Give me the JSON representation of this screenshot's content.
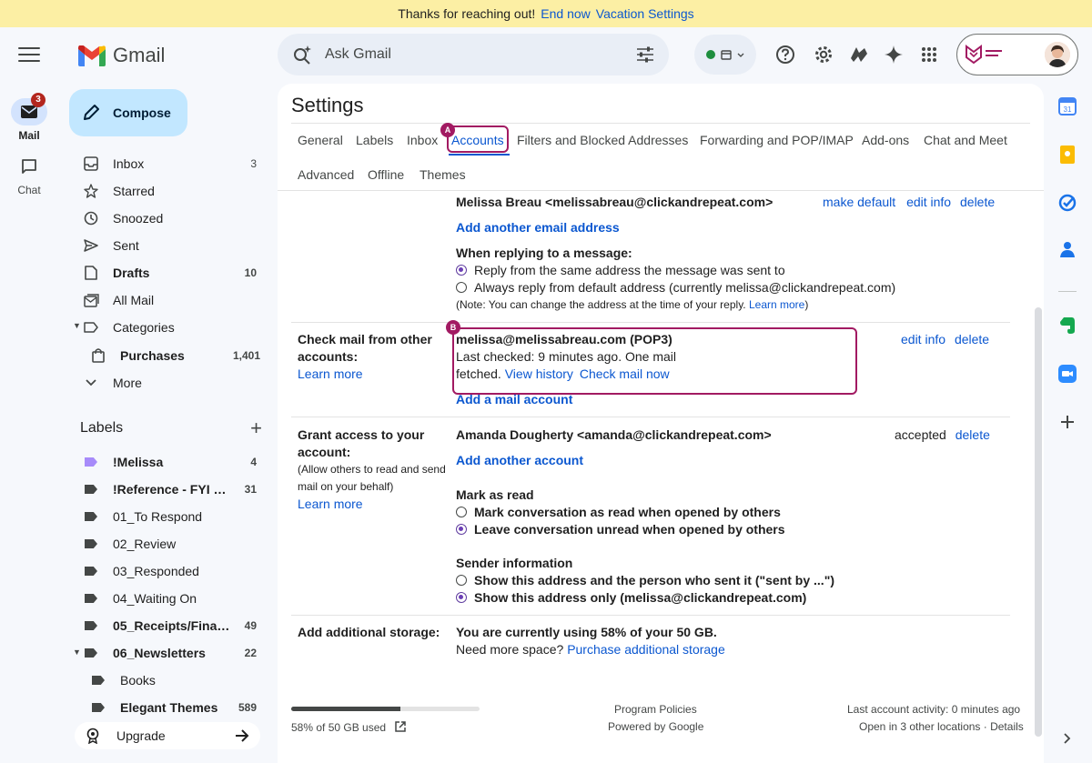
{
  "banner": {
    "text": "Thanks for reaching out!",
    "end_now": "End now",
    "vacation_settings": "Vacation Settings"
  },
  "rail": {
    "mail_label": "Mail",
    "mail_badge": "3",
    "chat_label": "Chat"
  },
  "app": {
    "name": "Gmail"
  },
  "compose_label": "Compose",
  "nav": [
    {
      "label": "Inbox",
      "count": "3",
      "icon": "inbox-icon",
      "bold": true
    },
    {
      "label": "Starred",
      "count": "",
      "icon": "star-icon",
      "bold": false
    },
    {
      "label": "Snoozed",
      "count": "",
      "icon": "clock-icon",
      "bold": false
    },
    {
      "label": "Sent",
      "count": "",
      "icon": "send-icon",
      "bold": false
    },
    {
      "label": "Drafts",
      "count": "10",
      "icon": "draft-icon",
      "bold": true
    },
    {
      "label": "All Mail",
      "count": "",
      "icon": "all-mail-icon",
      "bold": false
    },
    {
      "label": "Categories",
      "count": "",
      "icon": "label-icon",
      "bold": false
    },
    {
      "label": "Purchases",
      "count": "1,401",
      "icon": "shopping-bag-icon",
      "bold": true
    },
    {
      "label": "More",
      "count": "",
      "icon": "chevron-down-icon",
      "bold": false
    }
  ],
  "labels_heading": "Labels",
  "labels": [
    {
      "label": "!Melissa",
      "count": "4",
      "bold": true,
      "color": "#a78bfa"
    },
    {
      "label": "!Reference - FYI + ...",
      "count": "31",
      "bold": true,
      "color": "#444746"
    },
    {
      "label": "01_To Respond",
      "count": "",
      "bold": false,
      "color": "#444746"
    },
    {
      "label": "02_Review",
      "count": "",
      "bold": false,
      "color": "#444746"
    },
    {
      "label": "03_Responded",
      "count": "",
      "bold": false,
      "color": "#444746"
    },
    {
      "label": "04_Waiting On",
      "count": "",
      "bold": false,
      "color": "#444746"
    },
    {
      "label": "05_Receipts/Finan...",
      "count": "49",
      "bold": true,
      "color": "#444746"
    },
    {
      "label": "06_Newsletters",
      "count": "22",
      "bold": true,
      "color": "#444746"
    },
    {
      "label": "Books",
      "count": "",
      "bold": false,
      "color": "#444746"
    },
    {
      "label": "Elegant Themes",
      "count": "589",
      "bold": true,
      "color": "#444746"
    }
  ],
  "upgrade_label": "Upgrade",
  "search": {
    "placeholder": "Ask Gmail"
  },
  "settings": {
    "title": "Settings",
    "tabs": [
      "General",
      "Labels",
      "Inbox",
      "Accounts",
      "Filters and Blocked Addresses",
      "Forwarding and POP/IMAP",
      "Add-ons",
      "Chat and Meet",
      "Advanced",
      "Offline",
      "Themes"
    ],
    "active_tab": "Accounts",
    "send_as": {
      "address": "Melissa Breau <melissabreau@clickandrepeat.com>",
      "make_default": "make default",
      "edit_info": "edit info",
      "delete": "delete",
      "add_another": "Add another email address",
      "reply_heading": "When replying to a message:",
      "reply_option_1": "Reply from the same address the message was sent to",
      "reply_option_2": "Always reply from default address (currently melissa@clickandrepeat.com)",
      "note": "(Note: You can change the address at the time of your reply.",
      "note_link": "Learn more",
      "note_end": ")"
    },
    "check_mail": {
      "label_line1": "Check mail from other",
      "label_line2": "accounts:",
      "learn_more": "Learn more",
      "account": "melissa@melissabreau.com (POP3)",
      "status_line1": "Last checked: 9 minutes ago. One mail",
      "status_line2": "fetched.",
      "view_history": "View history",
      "check_now": "Check mail now",
      "add_account": "Add a mail account",
      "edit_info": "edit info",
      "delete": "delete"
    },
    "grant_access": {
      "label_line1": "Grant access to your",
      "label_line2": "account:",
      "small_line1": "(Allow others to read and send",
      "small_line2": "mail on your behalf)",
      "learn_more": "Learn more",
      "delegate": "Amanda Dougherty <amanda@clickandrepeat.com>",
      "status": "accepted",
      "delete": "delete",
      "add_another": "Add another account",
      "mark_heading": "Mark as read",
      "mark_option_1": "Mark conversation as read when opened by others",
      "mark_option_2": "Leave conversation unread when opened by others",
      "sender_heading": "Sender information",
      "sender_option_1": "Show this address and the person who sent it (\"sent by ...\")",
      "sender_option_2": "Show this address only (melissa@clickandrepeat.com)"
    },
    "storage": {
      "label": "Add additional storage:",
      "usage": "You are currently using 58% of your 50 GB.",
      "need_more": "Need more space?",
      "purchase": "Purchase additional storage"
    }
  },
  "annotations": {
    "marker_a": "A",
    "marker_b": "B"
  },
  "footer": {
    "storage_used": "58% of 50 GB used",
    "storage_fraction": 0.58,
    "program_policies": "Program Policies",
    "powered_by": "Powered by Google",
    "last_activity": "Last account activity: 0 minutes ago",
    "open_in": "Open in 3 other locations",
    "details": "Details"
  },
  "colors": {
    "accent": "#0b57d0",
    "annotation": "#a21a62",
    "banner": "#fcefa4"
  }
}
